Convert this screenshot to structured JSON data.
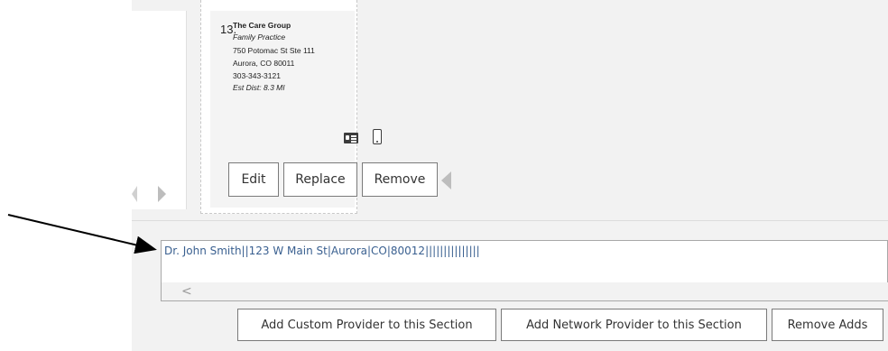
{
  "provider_card": {
    "number": "13.",
    "name": "The Care Group",
    "specialty": "Family Practice",
    "address_line1": "750 Potomac St Ste 111",
    "address_line2": "Aurora, CO 80011",
    "phone": "303-343-3121",
    "distance": "Est Dist: 8.3 MI",
    "icons": [
      "id-card-icon",
      "mobile-phone-icon"
    ],
    "buttons": {
      "edit": "Edit",
      "replace": "Replace",
      "remove": "Remove"
    }
  },
  "custom_entry": {
    "value": "Dr. John Smith||123 W Main St|Aurora|CO|80012|||||||||||||||",
    "scroll_left_glyph": "<"
  },
  "footer_buttons": {
    "add_custom": "Add Custom Provider to this Section",
    "add_network": "Add Network Provider to this Section",
    "remove_adds": "Remove Adds"
  },
  "colors": {
    "entry_text": "#3a6090",
    "panel_bg": "#f2f2f2",
    "arrow": "#000000"
  }
}
